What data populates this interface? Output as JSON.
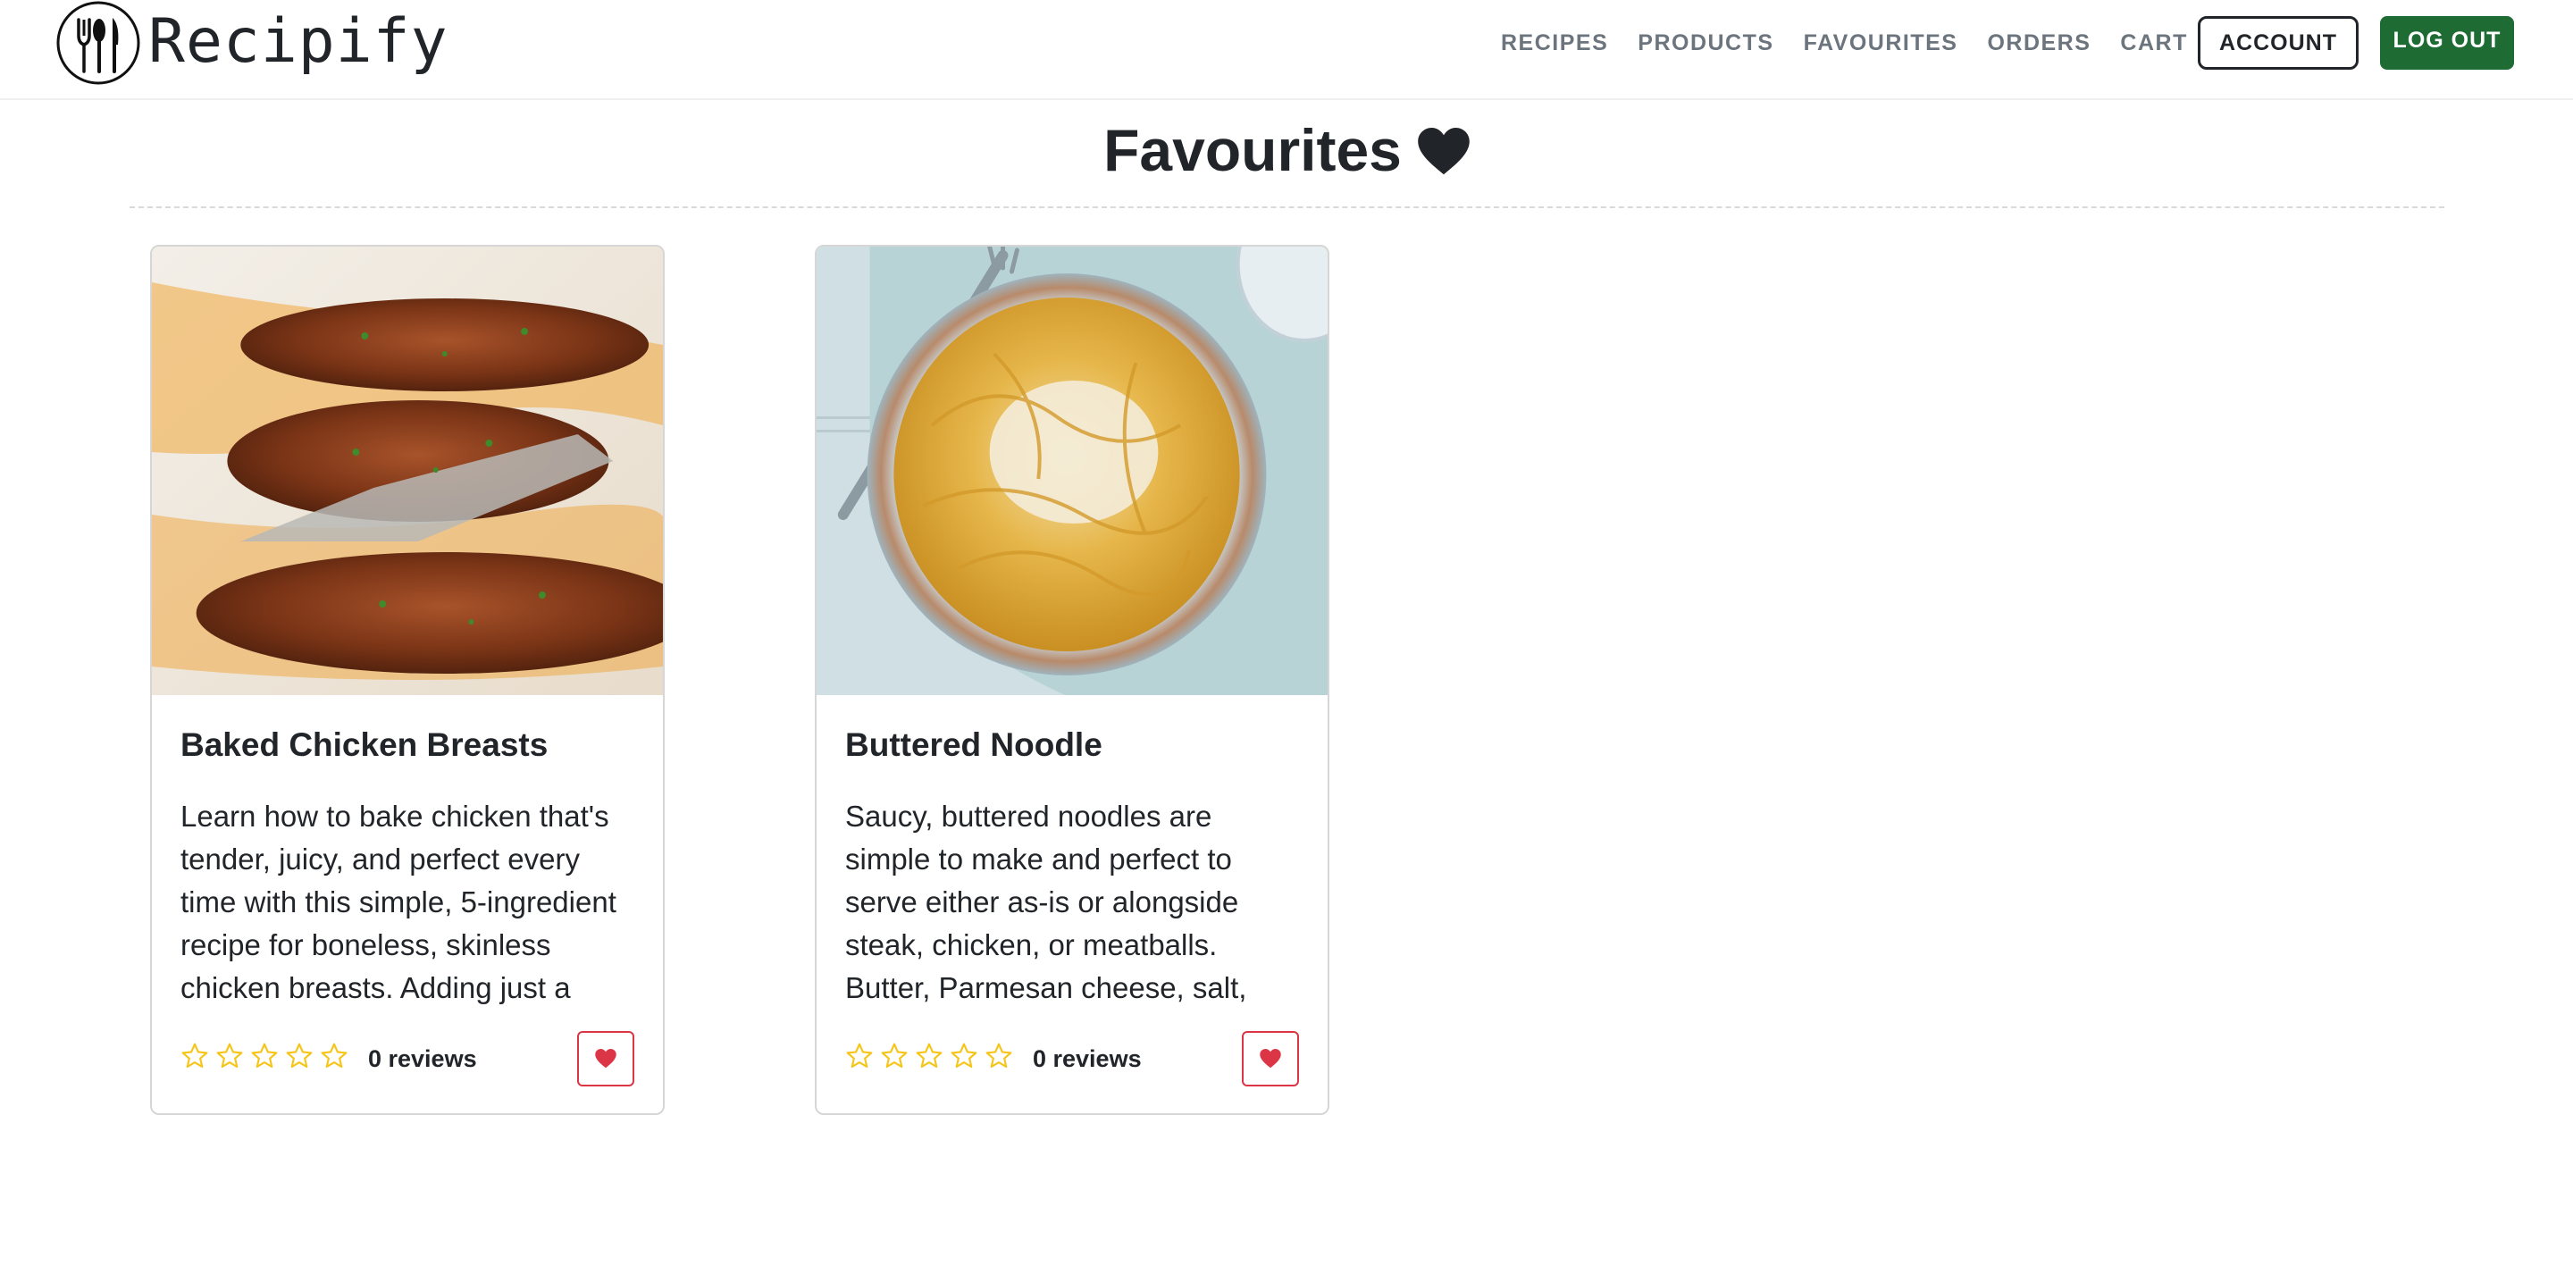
{
  "brand": {
    "name": "Recipify",
    "logo_icon": "fork-spoon-knife-icon"
  },
  "nav": {
    "items": [
      {
        "label": "RECIPES"
      },
      {
        "label": "PRODUCTS"
      },
      {
        "label": "FAVOURITES"
      },
      {
        "label": "ORDERS"
      },
      {
        "label": "CART"
      }
    ],
    "account_label": "ACCOUNT",
    "logout_label": "LOG OUT"
  },
  "page": {
    "title": "Favourites",
    "title_icon": "heart-icon"
  },
  "cards": [
    {
      "title": "Baked Chicken Breasts",
      "description": "Learn how to bake chicken that's tender, juicy, and perfect every time with this simple, 5-ingredient recipe for boneless, skinless chicken breasts. Adding just a bit...",
      "rating": 0,
      "reviews": "0 reviews",
      "image": "baked-chicken-photo"
    },
    {
      "title": "Buttered Noodle",
      "description": "Saucy, buttered noodles are simple to make and perfect to serve either as-is or alongside steak, chicken, or meatballs. Butter, Parmesan cheese, salt, an...",
      "rating": 0,
      "reviews": "0 reviews",
      "image": "buttered-noodles-photo"
    }
  ],
  "colors": {
    "brand_green": "#1e6b34",
    "star_yellow": "#f5c518",
    "favourite_red": "#dc3545",
    "nav_gray": "#6c757d"
  }
}
